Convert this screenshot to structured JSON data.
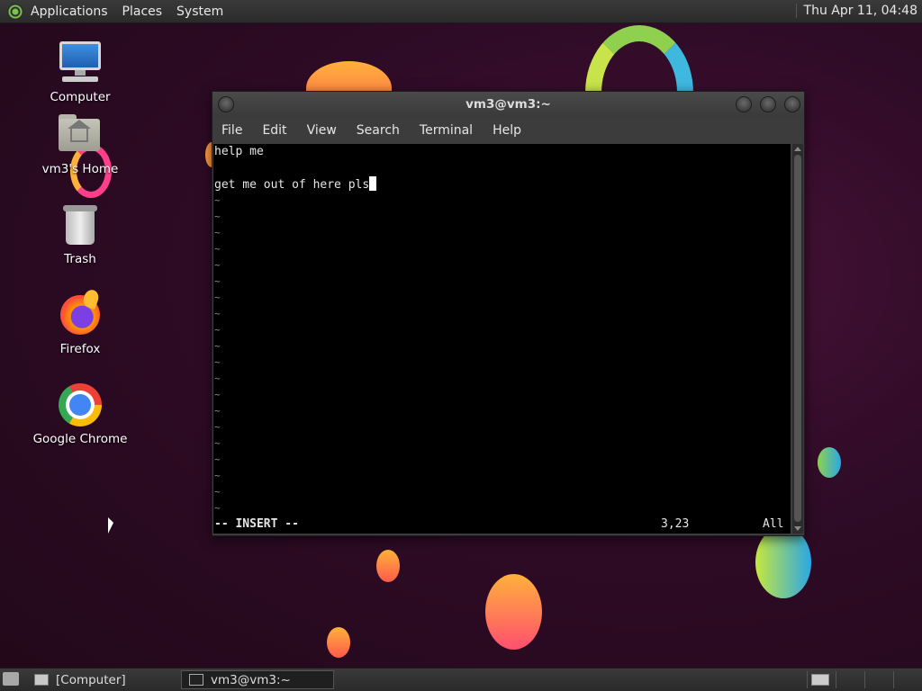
{
  "top_panel": {
    "menus": [
      "Applications",
      "Places",
      "System"
    ],
    "clock": "Thu Apr 11, 04:48"
  },
  "desktop_icons": {
    "computer": "Computer",
    "home": "vm3's Home",
    "trash": "Trash",
    "firefox": "Firefox",
    "chrome": "Google Chrome"
  },
  "terminal": {
    "title": "vm3@vm3:~",
    "menu": [
      "File",
      "Edit",
      "View",
      "Search",
      "Terminal",
      "Help"
    ],
    "lines": [
      "help me",
      "",
      "get me out of here pls"
    ],
    "tilde": "~",
    "mode": "-- INSERT --",
    "position": "3,23",
    "scroll": "All"
  },
  "taskbar": {
    "computer_task": "[Computer]",
    "terminal_task": "vm3@vm3:~"
  },
  "colors": {
    "background": "#2e0b26",
    "terminal_bg": "#000000",
    "tilde": "#8a8aa0"
  }
}
